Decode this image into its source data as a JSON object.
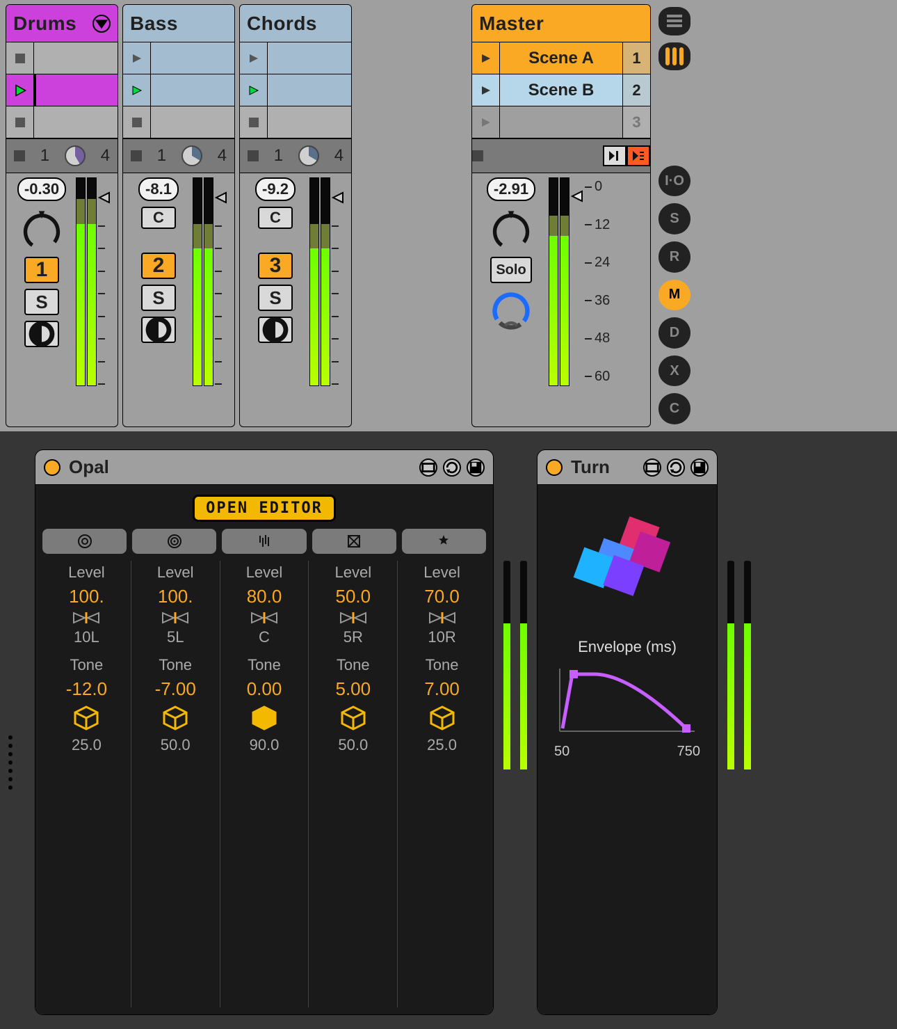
{
  "session": {
    "tracks": [
      {
        "name": "Drums",
        "db": "-0.30",
        "trackNum": "1",
        "stripA": "1",
        "stripB": "4",
        "hasC": false
      },
      {
        "name": "Bass",
        "db": "-8.1",
        "trackNum": "2",
        "stripA": "1",
        "stripB": "4",
        "hasC": true
      },
      {
        "name": "Chords",
        "db": "-9.2",
        "trackNum": "3",
        "stripA": "1",
        "stripB": "4",
        "hasC": true
      }
    ],
    "master": {
      "name": "Master",
      "db": "-2.91",
      "solo": "Solo",
      "scenes": [
        {
          "label": "Scene A",
          "num": "1"
        },
        {
          "label": "Scene B",
          "num": "2"
        },
        {
          "label": "",
          "num": "3"
        }
      ],
      "ticks": [
        "0",
        "12",
        "24",
        "36",
        "48",
        "60"
      ]
    },
    "c_label": "C",
    "s_label": "S"
  },
  "siderail": {
    "labels": [
      "I·O",
      "S",
      "R",
      "M",
      "D",
      "X",
      "C"
    ]
  },
  "devices": {
    "opal": {
      "name": "Opal",
      "openeditor": "OPEN EDITOR",
      "rowlabels": {
        "level": "Level",
        "tone": "Tone",
        "pan": "Pan"
      },
      "cols": [
        {
          "level": "100.",
          "pan": "10L",
          "tone": "-12.0",
          "wet": "25.0"
        },
        {
          "level": "100.",
          "pan": "5L",
          "tone": "-7.00",
          "wet": "50.0"
        },
        {
          "level": "80.0",
          "pan": "C",
          "tone": "0.00",
          "wet": "90.0"
        },
        {
          "level": "50.0",
          "pan": "5R",
          "tone": "5.00",
          "wet": "50.0"
        },
        {
          "level": "70.0",
          "pan": "10R",
          "tone": "7.00",
          "wet": "25.0"
        }
      ]
    },
    "turn": {
      "name": "Turn",
      "env_title": "Envelope (ms)",
      "env_a": "50",
      "env_b": "750"
    }
  }
}
